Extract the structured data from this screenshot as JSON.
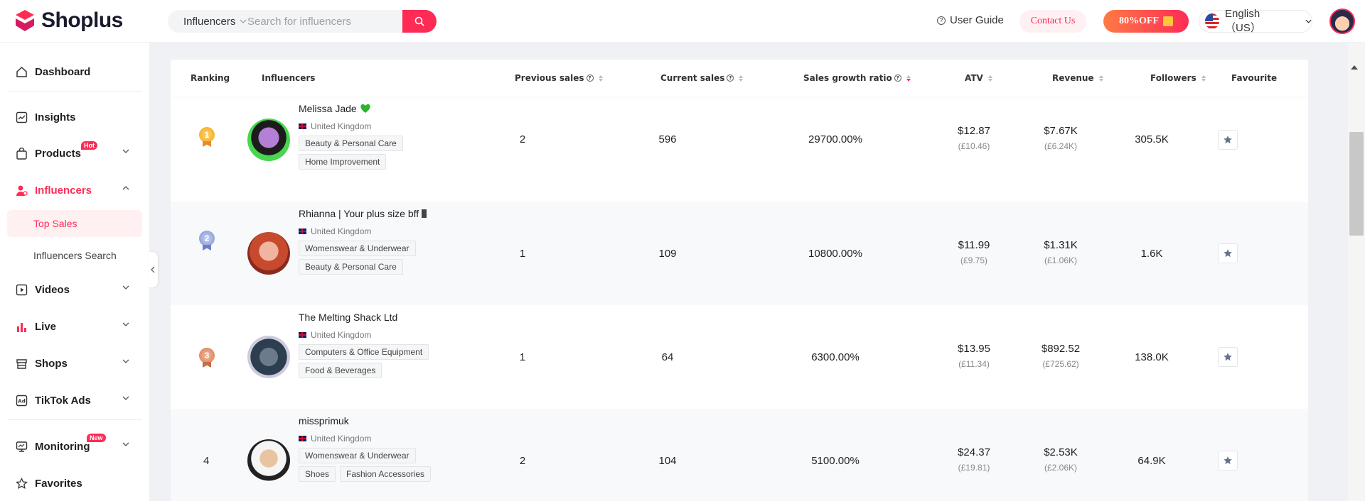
{
  "brand": {
    "name": "Shoplus",
    "accent": "#fe2c55"
  },
  "search": {
    "category": "Influencers",
    "placeholder": "Search for influencers"
  },
  "header": {
    "user_guide": "User Guide",
    "contact": "Contact Us",
    "promo": "80%OFF",
    "language": "English（US）"
  },
  "sidebar": {
    "items": [
      {
        "label": "Dashboard",
        "icon": "home-icon"
      },
      {
        "label": "Insights",
        "icon": "chart-line-icon"
      },
      {
        "label": "Products",
        "icon": "bag-icon",
        "badge": "Hot"
      },
      {
        "label": "Influencers",
        "icon": "user-icon"
      },
      {
        "label": "Videos",
        "icon": "video-icon"
      },
      {
        "label": "Live",
        "icon": "bar-chart-icon"
      },
      {
        "label": "Shops",
        "icon": "store-icon"
      },
      {
        "label": "TikTok Ads",
        "icon": "ad-icon"
      },
      {
        "label": "Monitoring",
        "icon": "monitor-icon",
        "badge": "New"
      },
      {
        "label": "Favorites",
        "icon": "star-icon"
      }
    ],
    "sub_items": [
      "Top Sales",
      "Influencers Search"
    ]
  },
  "table": {
    "headers": [
      "Ranking",
      "Influencers",
      "Previous sales",
      "Current sales",
      "Sales growth ratio",
      "ATV",
      "Revenue",
      "Followers",
      "Favourite"
    ],
    "rows": [
      {
        "rank": "1",
        "name": "Melissa Jade",
        "country": "United Kingdom",
        "tags": [
          "Beauty & Personal Care",
          "Home Improvement"
        ],
        "previous": "2",
        "current": "596",
        "growth": "29700.00%",
        "atv": "$12.87",
        "atv_local": "(£10.46)",
        "revenue": "$7.67K",
        "revenue_local": "(£6.24K)",
        "followers": "305.5K"
      },
      {
        "rank": "2",
        "name": "Rhianna | Your plus size bff",
        "country": "United Kingdom",
        "tags": [
          "Womenswear & Underwear",
          "Beauty & Personal Care"
        ],
        "previous": "1",
        "current": "109",
        "growth": "10800.00%",
        "atv": "$11.99",
        "atv_local": "(£9.75)",
        "revenue": "$1.31K",
        "revenue_local": "(£1.06K)",
        "followers": "1.6K"
      },
      {
        "rank": "3",
        "name": "The Melting Shack Ltd",
        "country": "United Kingdom",
        "tags": [
          "Computers & Office Equipment",
          "Food & Beverages"
        ],
        "previous": "1",
        "current": "64",
        "growth": "6300.00%",
        "atv": "$13.95",
        "atv_local": "(£11.34)",
        "revenue": "$892.52",
        "revenue_local": "(£725.62)",
        "followers": "138.0K"
      },
      {
        "rank": "4",
        "name": "missprimuk",
        "country": "United Kingdom",
        "tags": [
          "Womenswear & Underwear",
          "Shoes",
          "Fashion Accessories"
        ],
        "previous": "2",
        "current": "104",
        "growth": "5100.00%",
        "atv": "$24.37",
        "atv_local": "(£19.81)",
        "revenue": "$2.53K",
        "revenue_local": "(£2.06K)",
        "followers": "64.9K"
      }
    ]
  }
}
